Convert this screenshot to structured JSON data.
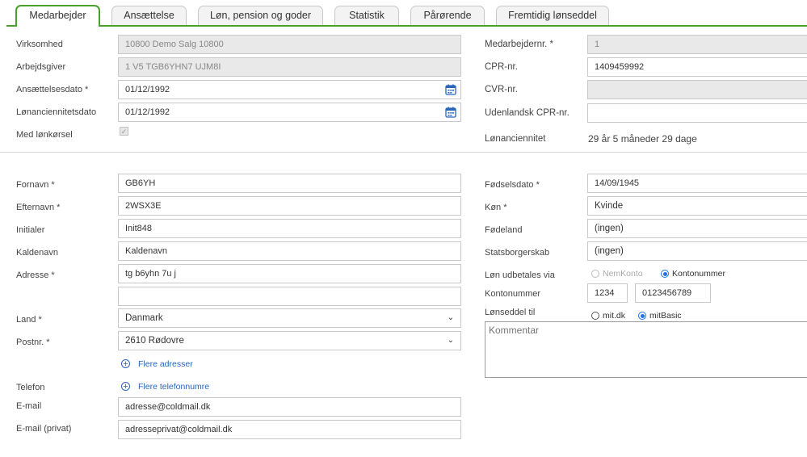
{
  "tabs": [
    {
      "label": "Medarbejder"
    },
    {
      "label": "Ansættelse"
    },
    {
      "label": "Løn, pension og goder"
    },
    {
      "label": "Statistik"
    },
    {
      "label": "Pårørende"
    },
    {
      "label": "Fremtidig lønseddel"
    }
  ],
  "employment": {
    "virksomhed_label": "Virksomhed",
    "virksomhed_value": "10800 Demo Salg 10800",
    "arbejdsgiver_label": "Arbejdsgiver",
    "arbejdsgiver_value": "1 V5 TGB6YHN7 UJM8I",
    "ansaettelsesdato_label": "Ansættelsesdato *",
    "ansaettelsesdato_value": "01/12/1992",
    "loenanciennitetsdato_label": "Lønanciennitetsdato",
    "loenanciennitetsdato_value": "01/12/1992",
    "med_loenkoersel_label": "Med lønkørsel",
    "med_loenkoersel_checked": true,
    "medarbejdernr_label": "Medarbejdernr. *",
    "medarbejdernr_value": "1",
    "cpr_label": "CPR-nr.",
    "cpr_value": "1409459992",
    "cvr_label": "CVR-nr.",
    "cvr_value": "",
    "udenlandsk_cpr_label": "Udenlandsk CPR-nr.",
    "udenlandsk_cpr_value": "",
    "loenanciennitet_label": "Lønanciennitet",
    "loenanciennitet_value": "29 år 5 måneder 29 dage"
  },
  "personal": {
    "fornavn_label": "Fornavn *",
    "fornavn_value": "GB6YH",
    "efternavn_label": "Efternavn *",
    "efternavn_value": "2WSX3E",
    "initialer_label": "Initialer",
    "initialer_value": "Init848",
    "kaldenavn_label": "Kaldenavn",
    "kaldenavn_value": "Kaldenavn",
    "adresse_label": "Adresse *",
    "adresse_value": "tg b6yhn 7u j",
    "adresse2_value": "",
    "land_label": "Land *",
    "land_value": "Danmark",
    "postnr_label": "Postnr. *",
    "postnr_value": "2610 Rødovre",
    "flere_adresser": "Flere adresser",
    "telefon_label": "Telefon",
    "flere_telefonnumre": "Flere telefonnumre",
    "email_label": "E-mail",
    "email_value": "adresse@coldmail.dk",
    "email_privat_label": "E-mail (privat)",
    "email_privat_value": "adresseprivat@coldmail.dk",
    "foedselsdato_label": "Fødselsdato *",
    "foedselsdato_value": "14/09/1945",
    "koen_label": "Køn *",
    "koen_value": "Kvinde",
    "foedeland_label": "Fødeland",
    "foedeland_value": "(ingen)",
    "statsborgerskab_label": "Statsborgerskab",
    "statsborgerskab_value": "(ingen)",
    "loen_udbetales_label": "Løn udbetales via",
    "nemkonto_label": "NemKonto",
    "kontonummer_option_label": "Kontonummer",
    "payment_selected": "Kontonummer",
    "kontonummer_label": "Kontonummer",
    "reg_nr_value": "1234",
    "konto_nr_value": "0123456789",
    "loenseddel_label": "Lønseddel til",
    "mitdk_label": "mit.dk",
    "mitbasic_label": "mitBasic",
    "loenseddel_selected": "mitBasic",
    "kommentar_placeholder": "Kommentar"
  },
  "colors": {
    "accent_green": "#4aa02c",
    "link_blue": "#2a66b8",
    "radio_blue": "#1a73e8"
  },
  "icons": {
    "calendar": "calendar-icon",
    "add": "plus-circle-icon",
    "dropdown": "chevron-down-icon"
  }
}
